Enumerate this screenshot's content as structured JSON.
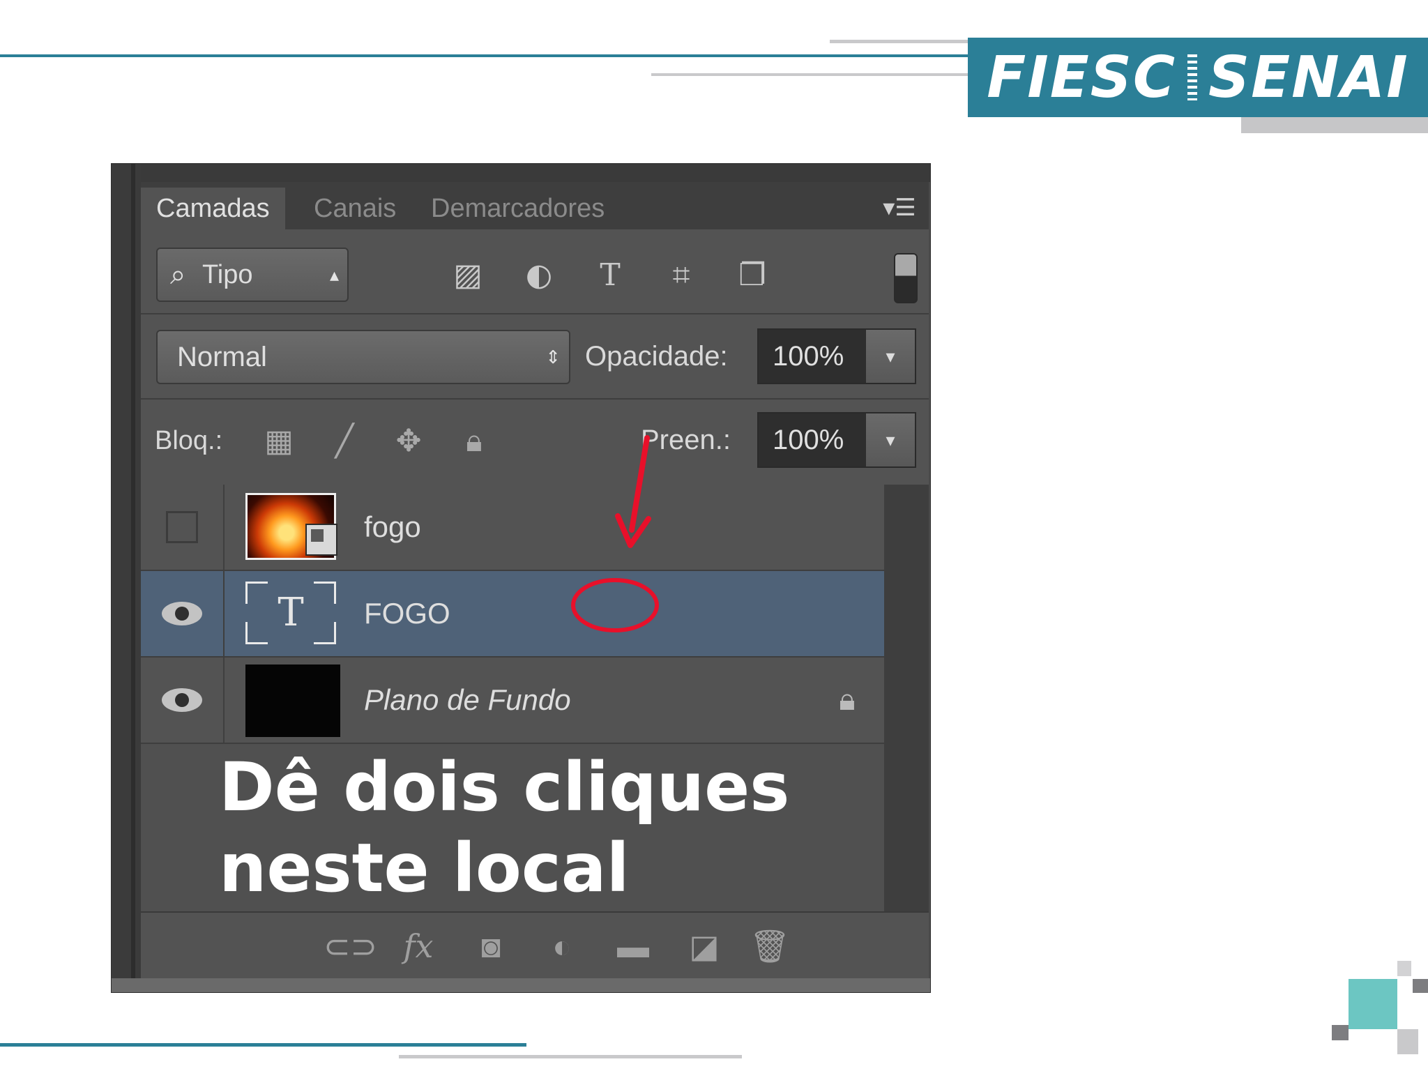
{
  "brand": {
    "left_text": "FIESC",
    "right_text": "SENAI",
    "color": "#2b7f97"
  },
  "panel": {
    "tabs": [
      {
        "label": "Camadas",
        "active": true
      },
      {
        "label": "Canais",
        "active": false
      },
      {
        "label": "Demarcadores",
        "active": false
      }
    ],
    "menu_icon": "panel-menu-icon",
    "filter": {
      "label": "Tipo",
      "icons": [
        "image-filter-icon",
        "adjustment-filter-icon",
        "type-filter-icon",
        "shape-filter-icon",
        "smart-object-filter-icon"
      ]
    },
    "blend_mode": "Normal",
    "opacity_label": "Opacidade:",
    "opacity_value": "100%",
    "lock_label": "Bloq.:",
    "lock_icons": [
      "lock-transparent-pixels-icon",
      "lock-image-pixels-icon",
      "lock-position-icon",
      "lock-all-icon"
    ],
    "fill_label": "Preen.:",
    "fill_value": "100%",
    "layers": [
      {
        "name": "fogo",
        "visible": false,
        "type": "smart-object"
      },
      {
        "name": "FOGO",
        "visible": true,
        "type": "text",
        "selected": true
      },
      {
        "name": "Plano de Fundo",
        "visible": true,
        "type": "background",
        "locked": true
      }
    ],
    "footer_icons": [
      "link-layers-icon",
      "fx-icon",
      "layer-mask-icon",
      "adjustment-layer-icon",
      "group-folder-icon",
      "new-layer-icon",
      "trash-icon"
    ]
  },
  "caption": {
    "line1": "Dê dois cliques",
    "line2": "neste local"
  },
  "colors": {
    "accent": "#2b7f97",
    "annotation": "#e8102a",
    "selection": "#4f6278",
    "corner_teal": "#6cc6c2"
  }
}
